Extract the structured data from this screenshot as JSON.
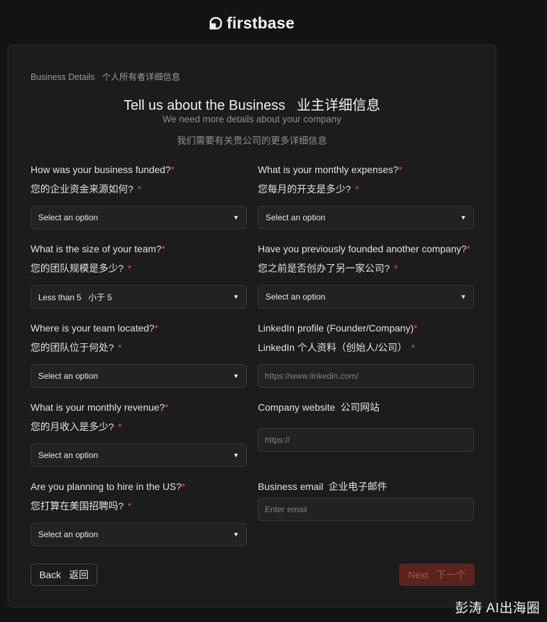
{
  "brand": {
    "name": "firstbase",
    "icon": "firstbase-logo-icon"
  },
  "breadcrumb": "Business Details   个人所有者详细信息",
  "title": "Tell us about the Business   业主详细信息",
  "subtitle": "We need more details about your company",
  "subtitle_cn": "我们需要有关贵公司的更多详细信息",
  "fields": {
    "funded": {
      "label": "How was your business funded?",
      "label_cn": "您的企业资金来源如何?",
      "value": "Select an option"
    },
    "expenses": {
      "label": "What is your monthly expenses?",
      "label_cn": "您每月的开支是多少?",
      "value": "Select an option"
    },
    "team_size": {
      "label": "What is the size of your team?",
      "label_cn": "您的团队规模是多少?",
      "value": "Less than 5   小于 5"
    },
    "founded_before": {
      "label": "Have you previously founded another company?",
      "label_cn": "您之前是否创办了另一家公司?",
      "value": "Select an option"
    },
    "team_location": {
      "label": "Where is your team located?",
      "label_cn": "您的团队位于何处?",
      "value": "Select an option"
    },
    "linkedin": {
      "label": "LinkedIn profile (Founder/Company)",
      "label_cn": "LinkedIn 个人资料（创始人/公司）",
      "placeholder": "https://www.linkedin.com/"
    },
    "revenue": {
      "label": "What is your monthly revenue?",
      "label_cn": "您的月收入是多少?",
      "value": "Select an option"
    },
    "website": {
      "label": "Company website  公司网站",
      "placeholder": "https://"
    },
    "hire_us": {
      "label": "Are you planning to hire in the US?",
      "label_cn": "您打算在美国招聘吗?",
      "value": "Select an option"
    },
    "email": {
      "label": "Business email  企业电子邮件",
      "placeholder": "Enter email"
    }
  },
  "required_mark": "*",
  "buttons": {
    "back": "Back   返回",
    "next": "Next   下一个"
  },
  "watermark": "彭涛 AI出海圈",
  "colors": {
    "background": "#131313",
    "card": "#1c1c1c",
    "required": "#e5484d",
    "next_button": "#5c231e"
  }
}
